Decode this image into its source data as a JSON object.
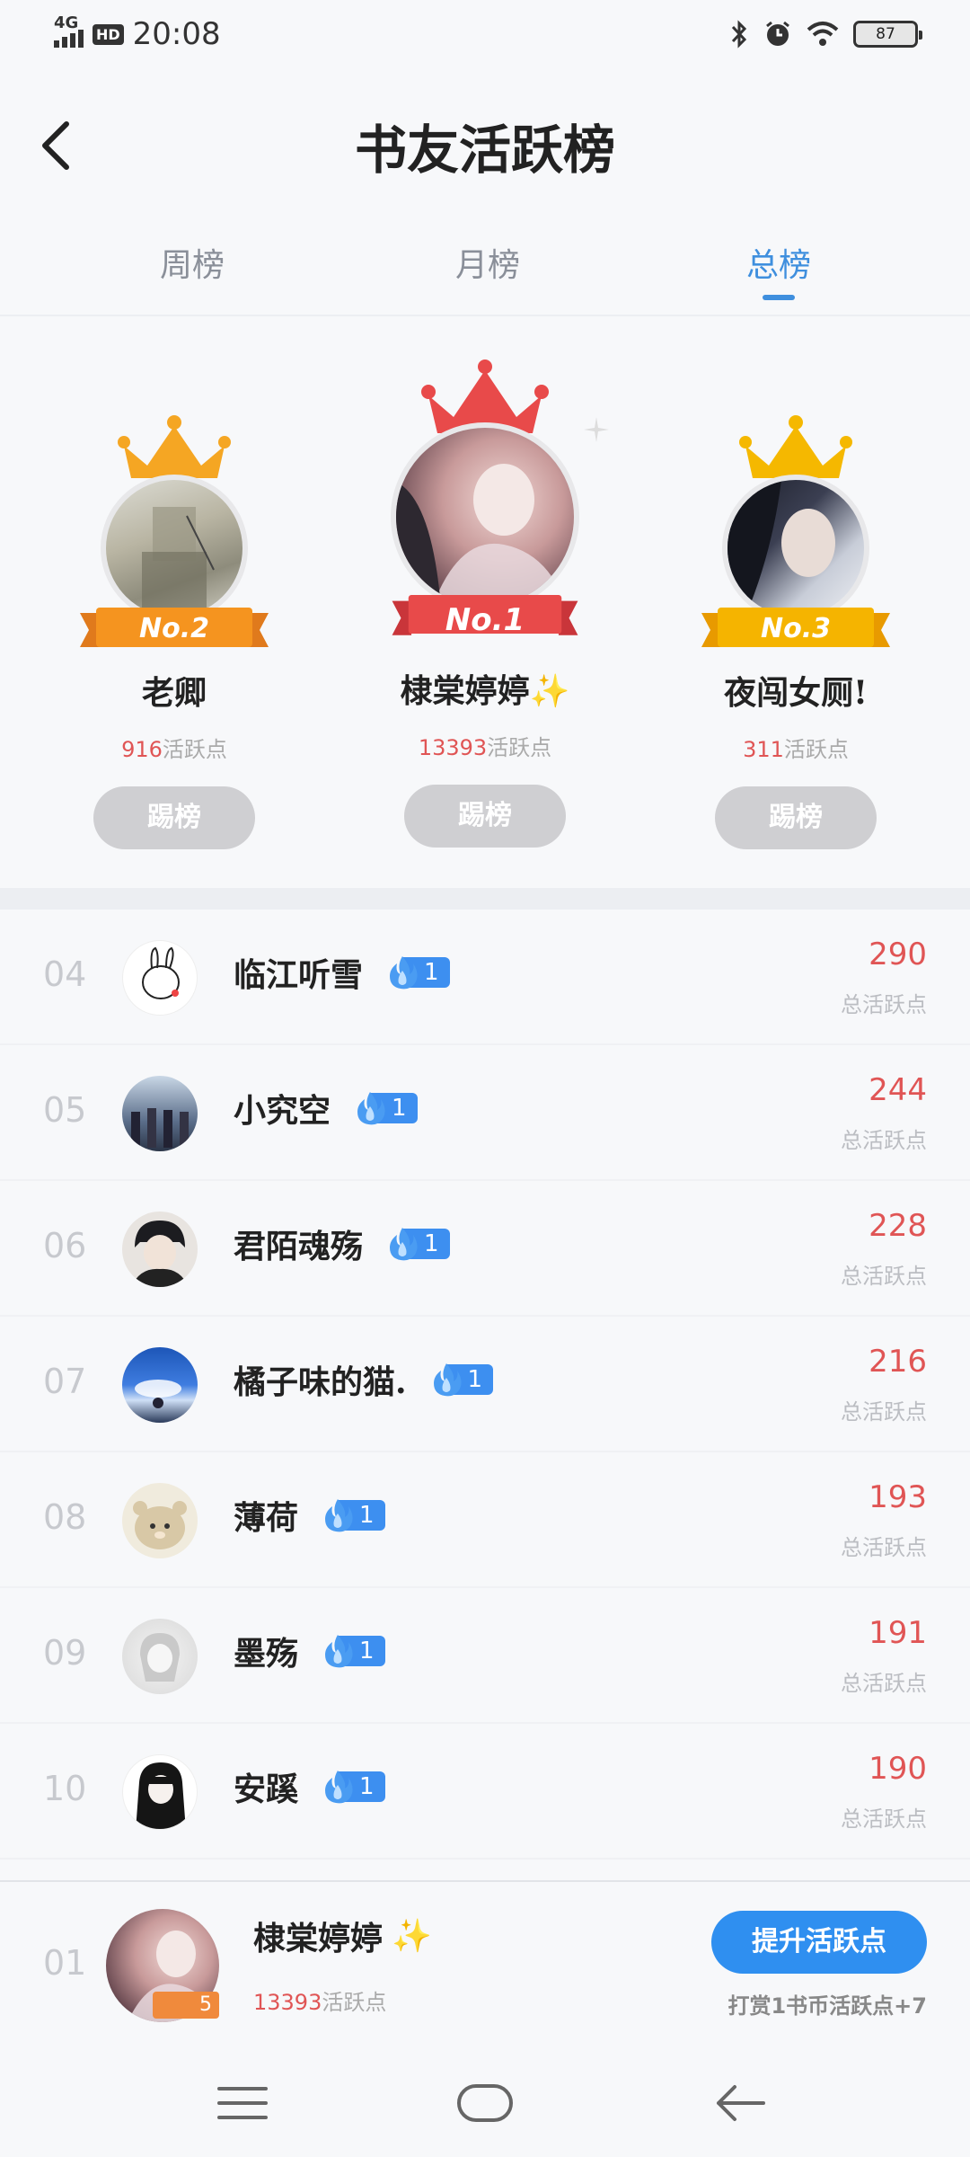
{
  "status": {
    "network": "4G",
    "hd": "HD",
    "time": "20:08",
    "battery": "87"
  },
  "header": {
    "title": "书友活跃榜"
  },
  "tabs": [
    {
      "label": "周榜"
    },
    {
      "label": "月榜"
    },
    {
      "label": "总榜"
    }
  ],
  "active_tab": "总榜",
  "podium": [
    {
      "rank_label": "No.2",
      "name": "老卿",
      "points": "916",
      "points_suffix": "活跃点",
      "kick_label": "踢榜"
    },
    {
      "rank_label": "No.1",
      "name": "棣棠婷婷✨",
      "points": "13393",
      "points_suffix": "活跃点",
      "kick_label": "踢榜"
    },
    {
      "rank_label": "No.3",
      "name": "夜闯女厕!",
      "points": "311",
      "points_suffix": "活跃点",
      "kick_label": "踢榜"
    }
  ],
  "list": [
    {
      "rank": "04",
      "name": "临江听雪",
      "level": "1",
      "score": "290",
      "score_label": "总活跃点"
    },
    {
      "rank": "05",
      "name": "小究空",
      "level": "1",
      "score": "244",
      "score_label": "总活跃点"
    },
    {
      "rank": "06",
      "name": "君陌魂殇",
      "level": "1",
      "score": "228",
      "score_label": "总活跃点"
    },
    {
      "rank": "07",
      "name": "橘子味的猫.",
      "level": "1",
      "score": "216",
      "score_label": "总活跃点"
    },
    {
      "rank": "08",
      "name": "薄荷",
      "level": "1",
      "score": "193",
      "score_label": "总活跃点"
    },
    {
      "rank": "09",
      "name": "墨殇",
      "level": "1",
      "score": "191",
      "score_label": "总活跃点"
    },
    {
      "rank": "10",
      "name": "安蹊",
      "level": "1",
      "score": "190",
      "score_label": "总活跃点"
    }
  ],
  "me": {
    "rank": "01",
    "name": "棣棠婷婷",
    "name_emoji": "✨",
    "badge": "5",
    "points": "13393",
    "points_suffix": "活跃点",
    "boost_label": "提升活跃点",
    "boost_hint": "打赏1书币活跃点+7"
  },
  "colors": {
    "accent": "#3f8fde",
    "score": "#e05555",
    "level": "#3d8ff0",
    "gold": "#f5a623",
    "red_crown": "#e84a4a"
  }
}
